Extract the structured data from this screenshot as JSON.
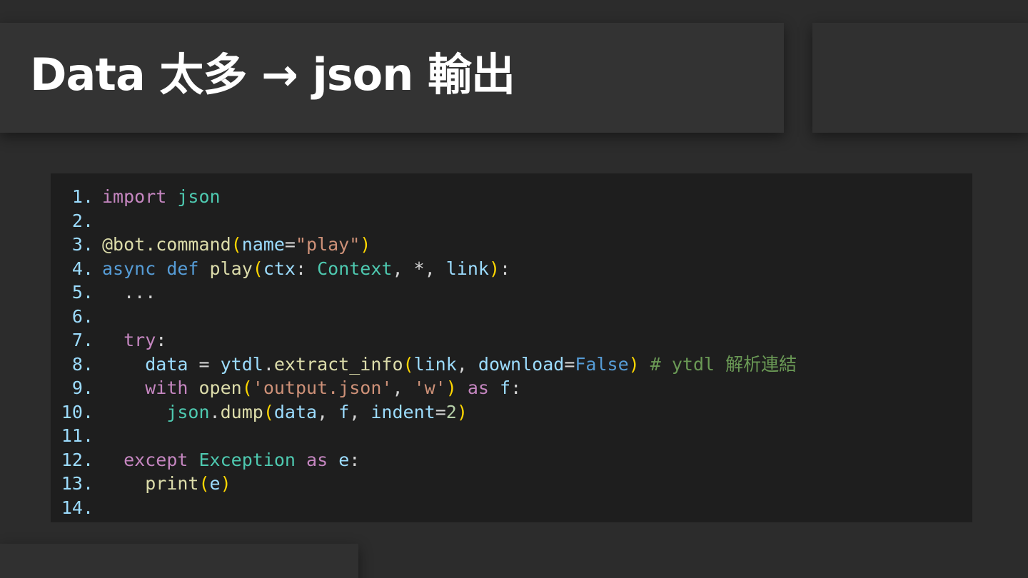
{
  "slide": {
    "title": "Data 太多 → json 輸出"
  },
  "colors": {
    "background": "#2c2c2c",
    "panel": "#333333",
    "code_bg": "#1e1e1e",
    "title_text": "#ffffff",
    "keyword_control": "#c586c0",
    "keyword_storage": "#569cd6",
    "type_name": "#4ec9b0",
    "function_name": "#dcdcaa",
    "variable": "#9cdcfe",
    "string": "#ce9178",
    "number": "#b5cea8",
    "bracket": "#ffd700",
    "comment": "#6a9955",
    "line_number": "#9cdcfe"
  },
  "code": {
    "language": "python",
    "lines": [
      {
        "num": "1.",
        "tokens": [
          [
            "kw",
            "import"
          ],
          [
            "pl",
            " "
          ],
          [
            "mod",
            "json"
          ]
        ]
      },
      {
        "num": "2.",
        "tokens": []
      },
      {
        "num": "3.",
        "tokens": [
          [
            "fn",
            "@bot.command"
          ],
          [
            "par",
            "("
          ],
          [
            "var",
            "name"
          ],
          [
            "pl",
            "="
          ],
          [
            "str",
            "\"play\""
          ],
          [
            "par",
            ")"
          ]
        ]
      },
      {
        "num": "4.",
        "tokens": [
          [
            "kw2",
            "async"
          ],
          [
            "pl",
            " "
          ],
          [
            "kw2",
            "def"
          ],
          [
            "pl",
            " "
          ],
          [
            "fn",
            "play"
          ],
          [
            "par",
            "("
          ],
          [
            "var",
            "ctx"
          ],
          [
            "pl",
            ": "
          ],
          [
            "mod",
            "Context"
          ],
          [
            "pl",
            ", *, "
          ],
          [
            "var",
            "link"
          ],
          [
            "par",
            ")"
          ],
          [
            "pl",
            ":"
          ]
        ]
      },
      {
        "num": "5.",
        "tokens": [
          [
            "pl",
            "  ..."
          ]
        ]
      },
      {
        "num": "6.",
        "tokens": []
      },
      {
        "num": "7.",
        "tokens": [
          [
            "pl",
            "  "
          ],
          [
            "kw",
            "try"
          ],
          [
            "pl",
            ":"
          ]
        ]
      },
      {
        "num": "8.",
        "tokens": [
          [
            "pl",
            "    "
          ],
          [
            "var",
            "data"
          ],
          [
            "pl",
            " = "
          ],
          [
            "var",
            "ytdl"
          ],
          [
            "pl",
            "."
          ],
          [
            "fn",
            "extract_info"
          ],
          [
            "par",
            "("
          ],
          [
            "var",
            "link"
          ],
          [
            "pl",
            ", "
          ],
          [
            "var",
            "download"
          ],
          [
            "pl",
            "="
          ],
          [
            "kw2",
            "False"
          ],
          [
            "par",
            ")"
          ],
          [
            "pl",
            " "
          ],
          [
            "cm",
            "# ytdl 解析連結"
          ]
        ]
      },
      {
        "num": "9.",
        "tokens": [
          [
            "pl",
            "    "
          ],
          [
            "kw",
            "with"
          ],
          [
            "pl",
            " "
          ],
          [
            "fn",
            "open"
          ],
          [
            "par",
            "("
          ],
          [
            "str",
            "'output.json'"
          ],
          [
            "pl",
            ", "
          ],
          [
            "str",
            "'w'"
          ],
          [
            "par",
            ")"
          ],
          [
            "pl",
            " "
          ],
          [
            "kw",
            "as"
          ],
          [
            "pl",
            " "
          ],
          [
            "var",
            "f"
          ],
          [
            "pl",
            ":"
          ]
        ]
      },
      {
        "num": "10.",
        "tokens": [
          [
            "pl",
            "      "
          ],
          [
            "mod",
            "json"
          ],
          [
            "pl",
            "."
          ],
          [
            "fn",
            "dump"
          ],
          [
            "par",
            "("
          ],
          [
            "var",
            "data"
          ],
          [
            "pl",
            ", "
          ],
          [
            "var",
            "f"
          ],
          [
            "pl",
            ", "
          ],
          [
            "var",
            "indent"
          ],
          [
            "pl",
            "="
          ],
          [
            "num",
            "2"
          ],
          [
            "par",
            ")"
          ]
        ]
      },
      {
        "num": "11.",
        "tokens": []
      },
      {
        "num": "12.",
        "tokens": [
          [
            "pl",
            "  "
          ],
          [
            "kw",
            "except"
          ],
          [
            "pl",
            " "
          ],
          [
            "mod",
            "Exception"
          ],
          [
            "pl",
            " "
          ],
          [
            "kw",
            "as"
          ],
          [
            "pl",
            " "
          ],
          [
            "var",
            "e"
          ],
          [
            "pl",
            ":"
          ]
        ]
      },
      {
        "num": "13.",
        "tokens": [
          [
            "pl",
            "    "
          ],
          [
            "fn",
            "print"
          ],
          [
            "par",
            "("
          ],
          [
            "var",
            "e"
          ],
          [
            "par",
            ")"
          ]
        ]
      },
      {
        "num": "14.",
        "tokens": []
      }
    ]
  }
}
